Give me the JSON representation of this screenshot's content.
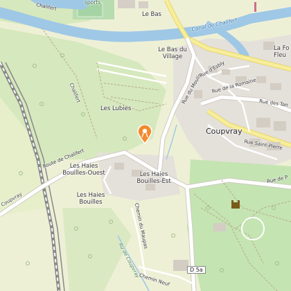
{
  "map": {
    "places": {
      "le_bas": "Le Bas",
      "le_bas_du_village": "Le Bas du Village",
      "les_lubies": "Les Lubies",
      "coupvray": "Coupvray",
      "les_haies_bouilles_ouest": "Les Haies Bouilles-Ouest",
      "les_haies_bouilles_est": "Les Haies Bouilles-Est",
      "les_haies_bouilles": "Les Haies Bouilles",
      "la_fo_fleu": "La Fo Fleu",
      "sports": "sports"
    },
    "roads": {
      "route_de_chalifert_left": "Route de Chalifert",
      "route_de_chalifert_top": "Chalifert",
      "canal": "Canal de Chalifert",
      "rue_du_moulin": "Rue du Moulin",
      "rue_d_esbly": "Rue d'Esbly",
      "rue_de_la_romaine": "Rue de la Romaine",
      "rue_des_tan": "Rue des Tan",
      "rue_saint_pierre": "Rue Saint-Pierre",
      "rue_de_p": "Rue de P",
      "chemin_du_maupas": "Chemin du Maupas",
      "ru_de_coupvray": "Ru de Coupvray",
      "chemin_neuf": "Chemin Neuf",
      "chalifert_path": "Chalifert",
      "d5a": "D 5a",
      "coupvray_road_left": "Coupvray"
    },
    "colors": {
      "water": "#9ec8e6",
      "forest": "#cfe3b4",
      "park": "#bfe3b0",
      "urban": "#e2ded8",
      "major_road": "#f6ee9a",
      "marker": "#f28a2e"
    }
  }
}
